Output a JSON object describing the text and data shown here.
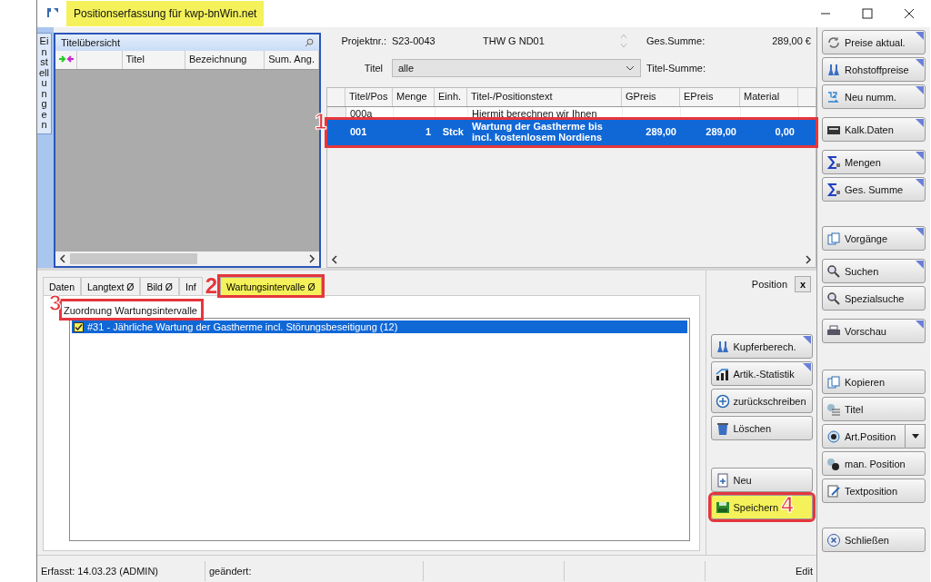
{
  "window": {
    "title": "Positionserfassung für kwp-bnWin.net",
    "title_highlighted": true
  },
  "side_tab": {
    "label": "Einstellungen"
  },
  "title_overview": {
    "title": "Titelübersicht",
    "columns": [
      "",
      "Titel",
      "Bezeichnung",
      "Sum. Ang."
    ]
  },
  "project": {
    "number_label": "Projektnr.:",
    "number": "S23-0043",
    "name": "THW G ND01",
    "total_label": "Ges.Summe:",
    "total": "289,00 €",
    "title_label": "Titel",
    "title_value": "alle",
    "title_sum_label": "Titel-Summe:"
  },
  "positions": {
    "columns": [
      "Titel/Pos",
      "Menge",
      "Einh.",
      "Titel-/Positionstext",
      "GPreis",
      "EPreis",
      "Material"
    ],
    "rows": [
      {
        "cells": [
          "000a",
          "",
          "",
          "Hiermit berechnen wir Ihnen",
          "",
          "",
          ""
        ],
        "selected": false
      },
      {
        "cells": [
          "001",
          "1",
          "Stck",
          "Wartung der Gastherme bis\nincl. kostenlosem Nordiens",
          "289,00",
          "289,00",
          "0,00"
        ],
        "selected": true,
        "callout": {
          "number": "1"
        }
      }
    ]
  },
  "detail_tabs": [
    {
      "label": "Daten",
      "selected": false,
      "highlighted": false
    },
    {
      "label": "Langtext Ø",
      "selected": false,
      "highlighted": false
    },
    {
      "label": "Bild Ø",
      "selected": false,
      "highlighted": false
    },
    {
      "label": "Inf",
      "selected": false,
      "highlighted": false
    },
    {
      "label": "Wartungsintervalle Ø",
      "selected": true,
      "highlighted": true,
      "callout": {
        "number": "2"
      }
    }
  ],
  "assignment": {
    "title": "Zuordnung Wartungsintervalle",
    "callout": {
      "number": "3"
    },
    "items": [
      {
        "label": "#31 - Jährliche Wartung der Gastherme incl. Störungsbeseitigung (12)",
        "checked": true,
        "selected": true,
        "highlighted": true
      }
    ]
  },
  "position_panel": {
    "label": "Position",
    "close": "x"
  },
  "position_buttons": [
    {
      "label": "Kupferberech.",
      "menu": true,
      "gap": true,
      "highlighted": false
    },
    {
      "label": "Artik.-Statistik",
      "menu": true,
      "gap": false,
      "highlighted": false
    },
    {
      "label": "zurückschreiben",
      "menu": false,
      "gap": false,
      "highlighted": false
    },
    {
      "label": "Löschen",
      "menu": false,
      "gap": false,
      "highlighted": false
    },
    {
      "label": "Neu",
      "menu": false,
      "gap": true,
      "highlighted": false
    },
    {
      "label": "Speichern",
      "menu": false,
      "gap": false,
      "highlighted": true,
      "callout": {
        "number": "4"
      }
    }
  ],
  "toolbar_groups": [
    [
      {
        "label": "Preise aktual.",
        "menu": true
      },
      {
        "label": "Rohstoffpreise",
        "menu": true
      },
      {
        "label": "Neu numm.",
        "menu": true
      }
    ],
    [
      {
        "label": "Kalk.Daten",
        "menu": true
      }
    ],
    [
      {
        "label": "Mengen",
        "menu": true
      },
      {
        "label": "Ges. Summe",
        "menu": true
      }
    ],
    [
      {
        "label": "Vorgänge",
        "menu": true
      }
    ],
    [
      {
        "label": "Suchen",
        "menu": true
      },
      {
        "label": "Spezialsuche",
        "menu": false
      }
    ],
    [
      {
        "label": "Vorschau",
        "menu": true
      }
    ],
    [
      {
        "label": "Kopieren",
        "menu": false
      },
      {
        "label": "Titel",
        "menu": false
      },
      {
        "label": "Art.Position",
        "menu": false,
        "dropdown": true
      },
      {
        "label": "man. Position",
        "menu": false
      },
      {
        "label": "Textposition",
        "menu": false
      }
    ],
    [
      {
        "label": "Schließen",
        "menu": false
      }
    ]
  ],
  "status_bar": {
    "created": "Erfasst: 14.03.23 (ADMIN)",
    "changed": "geändert:",
    "mode": "Edit"
  }
}
